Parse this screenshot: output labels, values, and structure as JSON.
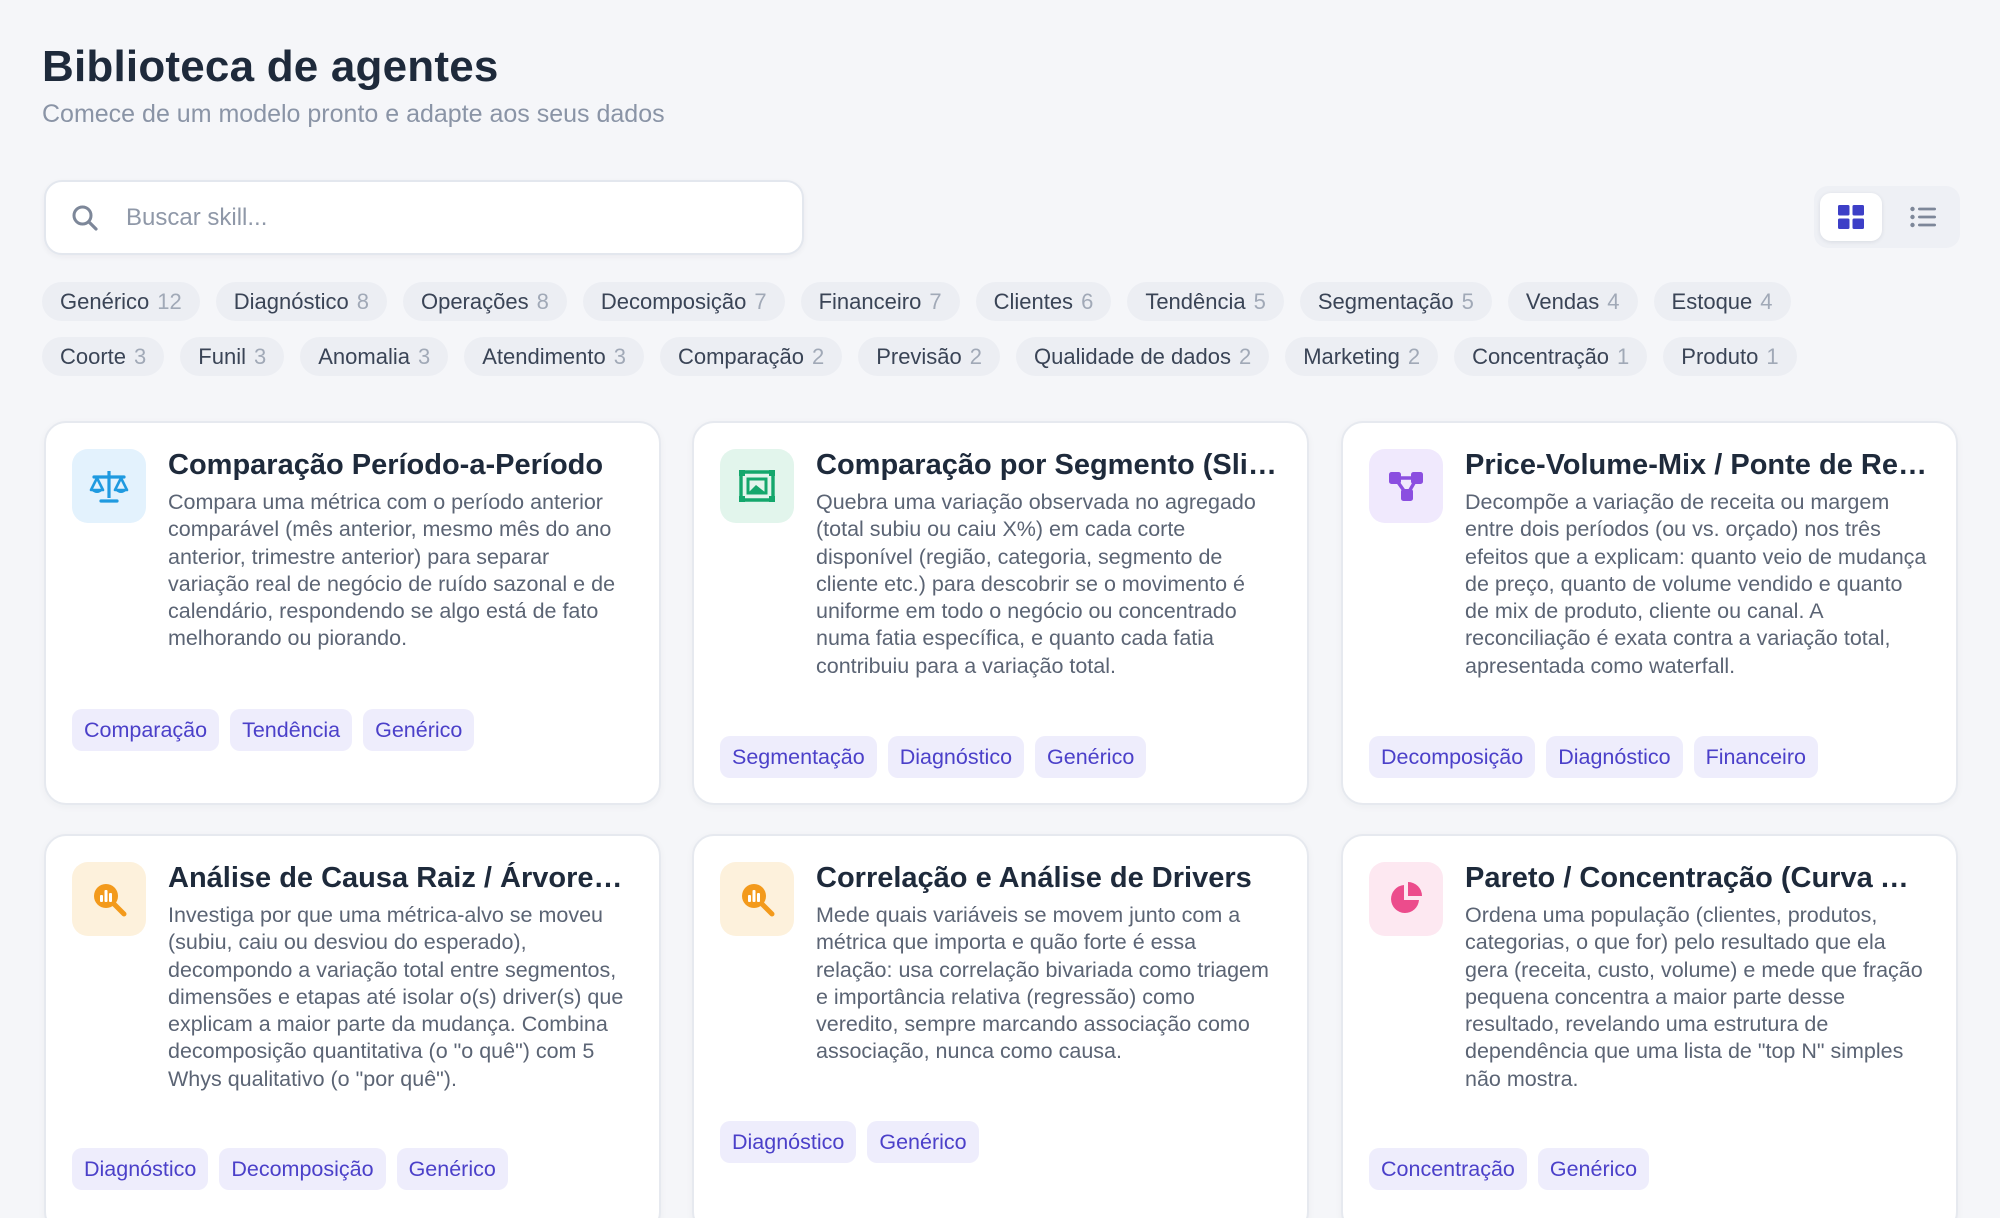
{
  "header": {
    "title": "Biblioteca de agentes",
    "subtitle": "Comece de um modelo pronto e adapte aos seus dados"
  },
  "search": {
    "placeholder": "Buscar skill...",
    "value": ""
  },
  "view_toggle": {
    "active": "grid",
    "options": [
      "grid-view-icon",
      "list-view-icon"
    ]
  },
  "filters": {
    "row1": [
      {
        "label": "Genérico",
        "count": "12"
      },
      {
        "label": "Diagnóstico",
        "count": "8"
      },
      {
        "label": "Operações",
        "count": "8"
      },
      {
        "label": "Decomposição",
        "count": "7"
      },
      {
        "label": "Financeiro",
        "count": "7"
      },
      {
        "label": "Clientes",
        "count": "6"
      },
      {
        "label": "Tendência",
        "count": "5"
      },
      {
        "label": "Segmentação",
        "count": "5"
      },
      {
        "label": "Vendas",
        "count": "4"
      },
      {
        "label": "Estoque",
        "count": "4"
      }
    ],
    "row2": [
      {
        "label": "Coorte",
        "count": "3"
      },
      {
        "label": "Funil",
        "count": "3"
      },
      {
        "label": "Anomalia",
        "count": "3"
      },
      {
        "label": "Atendimento",
        "count": "3"
      },
      {
        "label": "Comparação",
        "count": "2"
      },
      {
        "label": "Previsão",
        "count": "2"
      },
      {
        "label": "Qualidade de dados",
        "count": "2"
      },
      {
        "label": "Marketing",
        "count": "2"
      },
      {
        "label": "Concentração",
        "count": "1"
      },
      {
        "label": "Produto",
        "count": "1"
      }
    ]
  },
  "colors": {
    "accent": "#5b3fd4",
    "tag_text": "#4b40c9",
    "tag_bg": "#eeedfc"
  },
  "cards": [
    {
      "icon": "balance-scale-icon",
      "title": "Comparação Período-a-Período",
      "description": "Compara uma métrica com o período anterior comparável (mês anterior, mesmo mês do ano anterior, trimestre anterior) para separar variação real de negócio de ruído sazonal e de calendário, respondendo se algo está de fato melhorando ou piorando.",
      "tags": [
        "Comparação",
        "Tendência",
        "Genérico"
      ]
    },
    {
      "icon": "segment-frame-icon",
      "title": "Comparação por Segmento (Slice-and-Dice)",
      "description": "Quebra uma variação observada no agregado (total subiu ou caiu X%) em cada corte disponível (região, categoria, segmento de cliente etc.) para descobrir se o movimento é uniforme em todo o negócio ou concentrado numa fatia específica, e quanto cada fatia contribuiu para a variação total.",
      "tags": [
        "Segmentação",
        "Diagnóstico",
        "Genérico"
      ]
    },
    {
      "icon": "decomposition-tree-icon",
      "title": "Price-Volume-Mix / Ponte de Receita",
      "description": "Decompõe a variação de receita ou margem entre dois períodos (ou vs. orçado) nos três efeitos que a explicam: quanto veio de mudança de preço, quanto de volume vendido e quanto de mix de produto, cliente ou canal. A reconciliação é exata contra a variação total, apresentada como waterfall.",
      "tags": [
        "Decomposição",
        "Diagnóstico",
        "Financeiro"
      ]
    },
    {
      "icon": "magnifier-chart-icon",
      "title": "Análise de Causa Raiz / Árvore de Métricas",
      "description": "Investiga por que uma métrica-alvo se moveu (subiu, caiu ou desviou do esperado), decompondo a variação total entre segmentos, dimensões e etapas até isolar o(s) driver(s) que explicam a maior parte da mudança. Combina decomposição quantitativa (o \"o quê\") com 5 Whys qualitativo (o \"por quê\").",
      "tags": [
        "Diagnóstico",
        "Decomposição",
        "Genérico"
      ]
    },
    {
      "icon": "magnifier-chart-icon",
      "title": "Correlação e Análise de Drivers",
      "description": "Mede quais variáveis se movem junto com a métrica que importa e quão forte é essa relação: usa correlação bivariada como triagem e importância relativa (regressão) como veredito, sempre marcando associação como associação, nunca como causa.",
      "tags": [
        "Diagnóstico",
        "Genérico"
      ]
    },
    {
      "icon": "pie-chart-icon",
      "title": "Pareto / Concentração (Curva ABC)",
      "description": "Ordena uma população (clientes, produtos, categorias, o que for) pelo resultado que ela gera (receita, custo, volume) e mede que fração pequena concentra a maior parte desse resultado, revelando uma estrutura de dependência que uma lista de \"top N\" simples não mostra.",
      "tags": [
        "Concentração",
        "Genérico"
      ]
    }
  ]
}
